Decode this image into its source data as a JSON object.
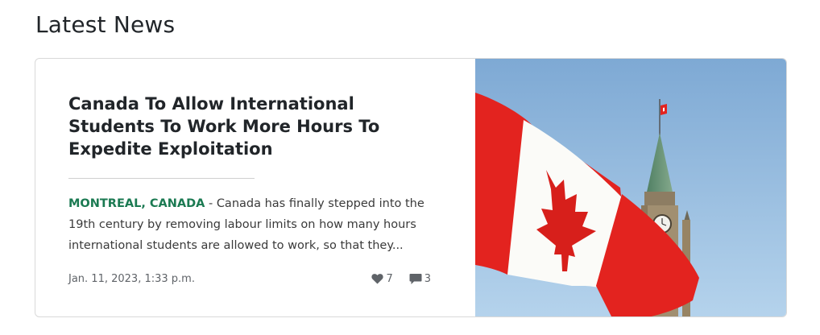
{
  "section": {
    "title": "Latest News"
  },
  "article": {
    "title": "Canada To Allow International Students To Work More Hours To Expedite Exploitation",
    "dateline": "MONTREAL, CANADA",
    "separator": " - ",
    "excerpt": "Canada has finally stepped into the 19th century by removing labour limits on how many hours international students are allowed to work, so that they...",
    "date": "Jan. 11, 2023, 1:33 p.m.",
    "likes": "7",
    "comments": "3"
  },
  "icons": {
    "likes": "heart-icon",
    "comments": "comment-icon"
  },
  "colors": {
    "dateline": "#1b7a52",
    "flag_red": "#e3231f",
    "sky": "#8fb9dd"
  }
}
